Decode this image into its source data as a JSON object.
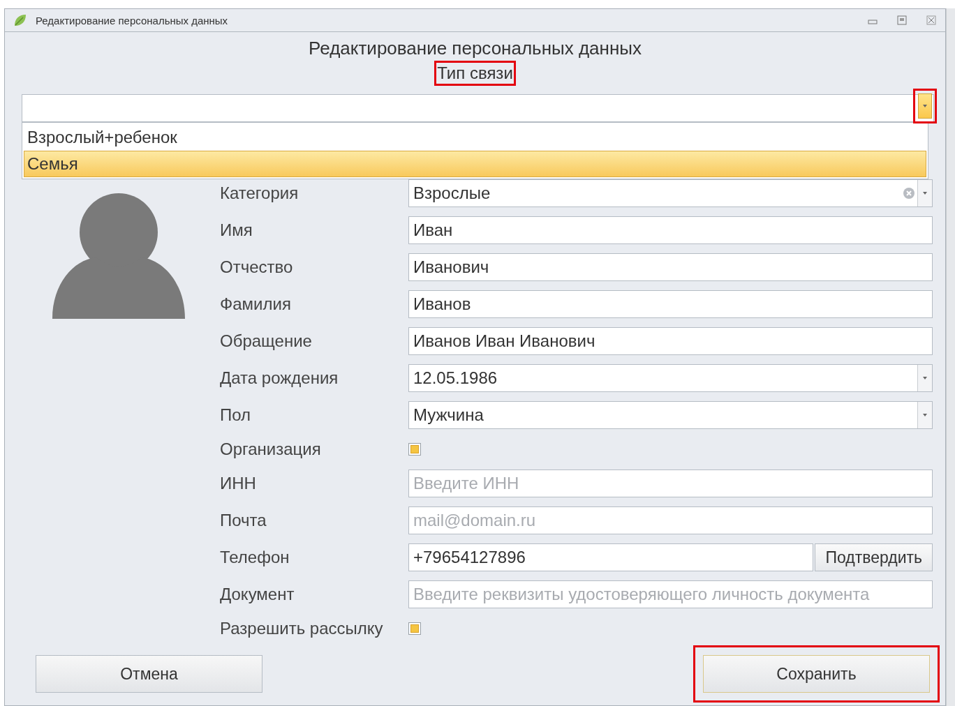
{
  "window": {
    "title": "Редактирование персональных данных"
  },
  "heading": "Редактирование персональных данных",
  "link_type": {
    "label": "Тип связи",
    "label_highlighted": true,
    "button_highlighted": true,
    "expanded": true,
    "options": [
      {
        "label": "Взрослый+ребенок",
        "selected": false
      },
      {
        "label": "Семья",
        "selected": true
      }
    ]
  },
  "fields": [
    {
      "kind": "combo",
      "label": "Категория",
      "value": "Взрослые"
    },
    {
      "kind": "text",
      "label": "Имя",
      "value": "Иван"
    },
    {
      "kind": "text",
      "label": "Отчество",
      "value": "Иванович"
    },
    {
      "kind": "text",
      "label": "Фамилия",
      "value": "Иванов"
    },
    {
      "kind": "text",
      "label": "Обращение",
      "value": "Иванов Иван Иванович"
    },
    {
      "kind": "dropdown",
      "label": "Дата рождения",
      "value": "12.05.1986"
    },
    {
      "kind": "dropdown",
      "label": "Пол",
      "value": "Мужчина"
    },
    {
      "kind": "checkbox",
      "label": "Организация",
      "indeterminate": true
    },
    {
      "kind": "text",
      "label": "ИНН",
      "placeholder": "Введите ИНН"
    },
    {
      "kind": "text",
      "label": "Почта",
      "placeholder": "mail@domain.ru"
    },
    {
      "kind": "phone",
      "label": "Телефон",
      "value": "+79654127896",
      "button": "Подтвердить"
    },
    {
      "kind": "text",
      "label": "Документ",
      "placeholder": "Введите реквизиты удостоверяющего личность документа"
    },
    {
      "kind": "checkbox",
      "label": "Разрешить рассылку",
      "indeterminate": true
    }
  ],
  "buttons": [
    {
      "label": "Отмена",
      "highlighted": false
    },
    {
      "label": "Сохранить",
      "highlighted": true
    }
  ]
}
